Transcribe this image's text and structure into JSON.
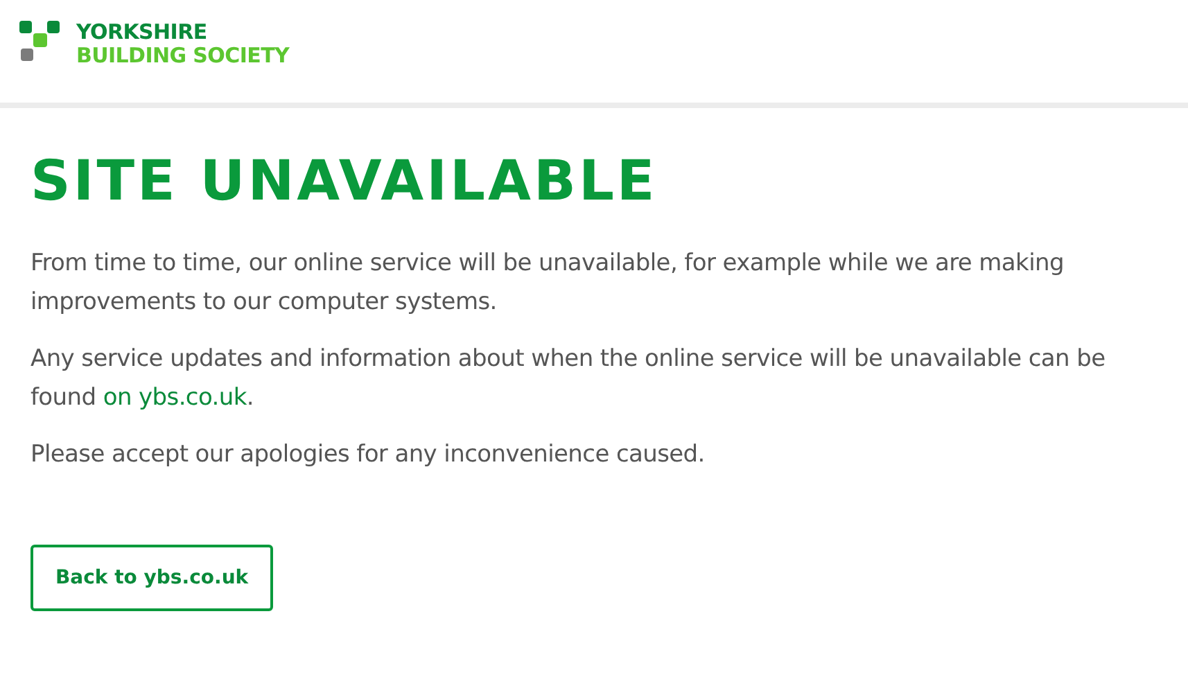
{
  "header": {
    "logo": {
      "line_1": "YORKSHIRE",
      "line_2": "BUILDING SOCIETY"
    }
  },
  "main": {
    "title": "SITE UNAVAILABLE",
    "paragraphs": [
      {
        "text": "From time to time, our online service will be unavailable, for example while we are making improvements to our computer systems."
      },
      {
        "text": "Any service updates and information about when the online service will be unavailable can be found ",
        "link": "on ybs.co.uk",
        "after": "."
      },
      {
        "text": "Please accept our apologies for any inconvenience caused."
      }
    ],
    "button": "Back to ybs.co.uk"
  }
}
